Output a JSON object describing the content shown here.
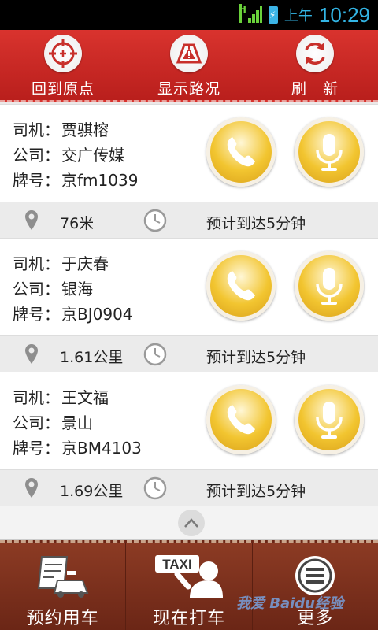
{
  "status_bar": {
    "network": "H",
    "ampm": "上午",
    "time": "10:29"
  },
  "toolbar": {
    "origin_label": "回到原点",
    "traffic_label": "显示路况",
    "refresh_label": "刷　新"
  },
  "drivers": [
    {
      "driver_key": "司机：",
      "driver": "贾骐榕",
      "company_key": "公司：",
      "company": "交广传媒",
      "plate_key": "牌号：",
      "plate": "京fm1039",
      "distance": "76米",
      "eta": "预计到达5分钟"
    },
    {
      "driver_key": "司机：",
      "driver": "于庆春",
      "company_key": "公司：",
      "company": "银海",
      "plate_key": "牌号：",
      "plate": "京BJ0904",
      "distance": "1.61公里",
      "eta": "预计到达5分钟"
    },
    {
      "driver_key": "司机：",
      "driver": "王文福",
      "company_key": "公司：",
      "company": "景山",
      "plate_key": "牌号：",
      "plate": "京BM4103",
      "distance": "1.69公里",
      "eta": "预计到达5分钟"
    }
  ],
  "bottom_nav": {
    "book_label": "预约用车",
    "hail_label": "现在打车",
    "hail_sign": "TAXI",
    "more_label": "更多"
  },
  "watermark": "我爱 Baidu经验",
  "colors": {
    "header_red": "#d9332e",
    "bottom_brown": "#7a2e1b",
    "gold": "#f2c530"
  }
}
